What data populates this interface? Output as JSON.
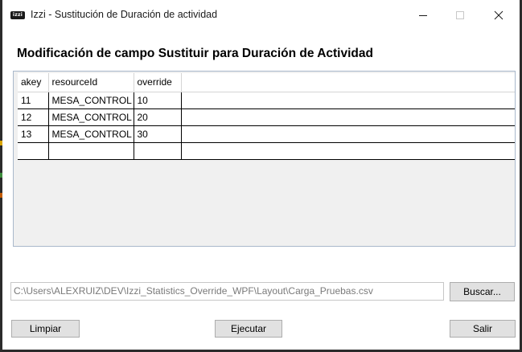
{
  "window": {
    "icon_label": "izzi",
    "title": "Izzi - Sustitución de Duración de actividad",
    "controls": [
      "minimize-icon",
      "maximize-icon",
      "close-icon"
    ]
  },
  "heading": "Modificación de campo Sustituir para Duración de Actividad",
  "grid": {
    "columns": [
      "akey",
      "resourceId",
      "override"
    ],
    "rows": [
      [
        "11",
        "MESA_CONTROL",
        "10"
      ],
      [
        "12",
        "MESA_CONTROL",
        "20"
      ],
      [
        "13",
        "MESA_CONTROL",
        "30"
      ]
    ]
  },
  "file": {
    "path": "C:\\Users\\ALEXRUIZ\\DEV\\Izzi_Statistics_Override_WPF\\Layout\\Carga_Pruebas.csv"
  },
  "buttons": {
    "buscar": "Buscar...",
    "limpiar": "Limpiar",
    "ejecutar": "Ejecutar",
    "salir": "Salir"
  },
  "colors": {
    "grid_border": "#a9b8cb",
    "grid_background": "#f0f0f0",
    "button_face": "#e1e1e1",
    "window_frame": "#2b2b2b"
  }
}
